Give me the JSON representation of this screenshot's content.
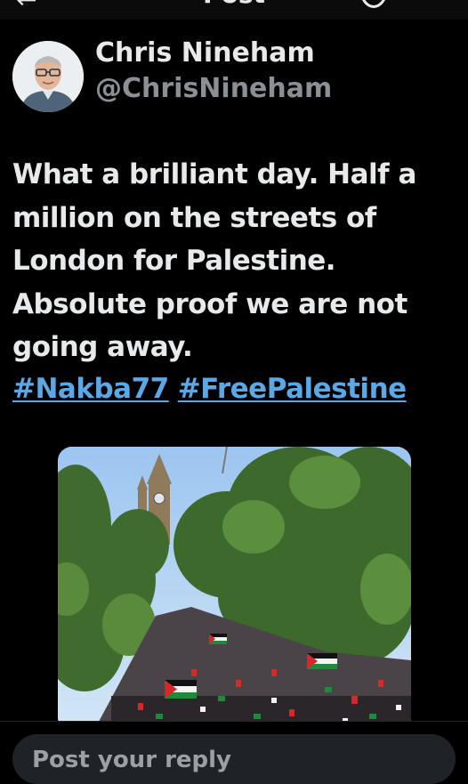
{
  "header": {
    "title": "Post"
  },
  "author": {
    "name": "Chris Nineham",
    "handle": "@ChrisNineham"
  },
  "tweet": {
    "lines": [
      "What a brilliant day. Half a",
      "million on the streets of",
      "London for Palestine.",
      "Absolute proof we are not",
      "going away."
    ],
    "hashtags": [
      "#Nakba77",
      "#FreePalestine"
    ]
  },
  "reply": {
    "placeholder": "Post your reply"
  },
  "colors": {
    "background": "#000000",
    "text": "#e7e9ea",
    "secondary": "#8b9096",
    "link": "#5aa8e6"
  }
}
